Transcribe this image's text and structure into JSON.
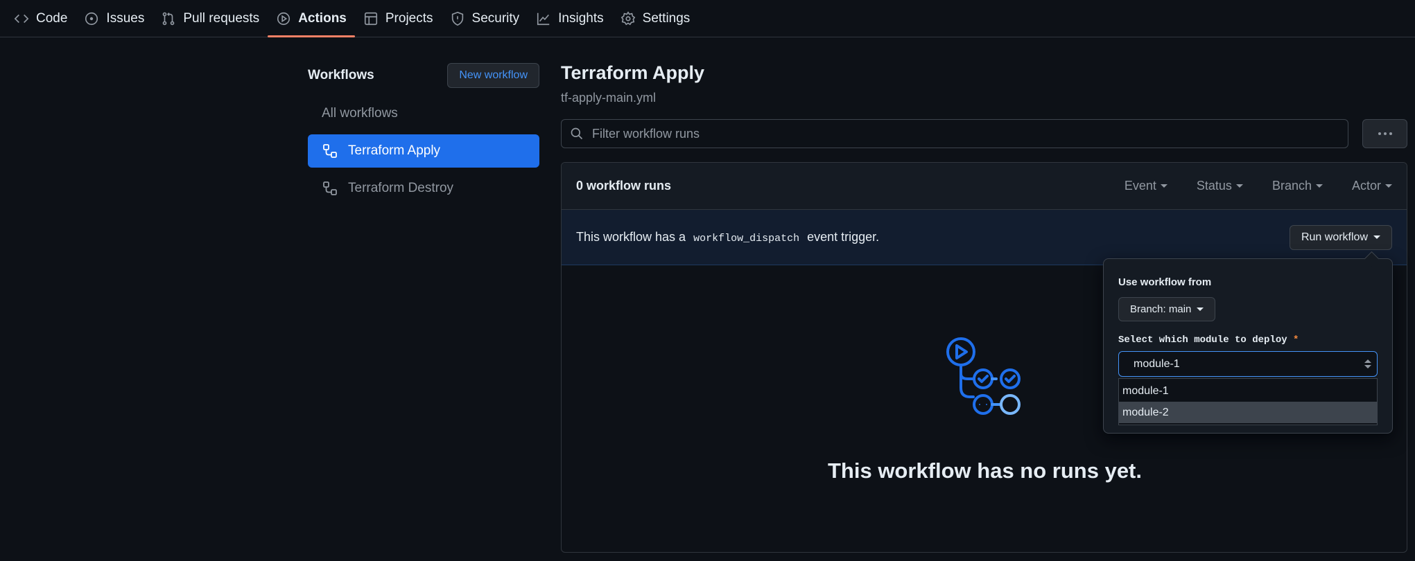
{
  "nav": {
    "tabs": [
      {
        "label": "Code",
        "icon": "code-icon"
      },
      {
        "label": "Issues",
        "icon": "issue-icon"
      },
      {
        "label": "Pull requests",
        "icon": "pull-request-icon"
      },
      {
        "label": "Actions",
        "icon": "play-icon",
        "active": true
      },
      {
        "label": "Projects",
        "icon": "table-icon"
      },
      {
        "label": "Security",
        "icon": "shield-icon"
      },
      {
        "label": "Insights",
        "icon": "graph-icon"
      },
      {
        "label": "Settings",
        "icon": "gear-icon"
      }
    ]
  },
  "sidebar": {
    "title": "Workflows",
    "new_workflow_label": "New workflow",
    "items": [
      {
        "label": "All workflows"
      },
      {
        "label": "Terraform Apply",
        "selected": true
      },
      {
        "label": "Terraform Destroy"
      }
    ]
  },
  "main": {
    "title": "Terraform Apply",
    "file": "tf-apply-main.yml",
    "filter_placeholder": "Filter workflow runs",
    "runs_count": "0 workflow runs",
    "filters": [
      "Event",
      "Status",
      "Branch",
      "Actor"
    ],
    "dispatch_prefix": "This workflow has a",
    "dispatch_code": "workflow_dispatch",
    "dispatch_suffix": "event trigger.",
    "run_workflow_label": "Run workflow",
    "empty_text": "This workflow has no runs yet."
  },
  "popover": {
    "use_from_label": "Use workflow from",
    "branch_label": "Branch: main",
    "module_label": "Select which module to deploy",
    "required_mark": "*",
    "selected_value": "module-1",
    "options": [
      "module-1",
      "module-2"
    ],
    "hovered_option": "module-2"
  },
  "colors": {
    "background": "#0d1117",
    "accent_blue": "#1f6feb",
    "link_blue": "#4493f8",
    "active_tab_underline": "#f78166",
    "required": "#f0883e"
  }
}
